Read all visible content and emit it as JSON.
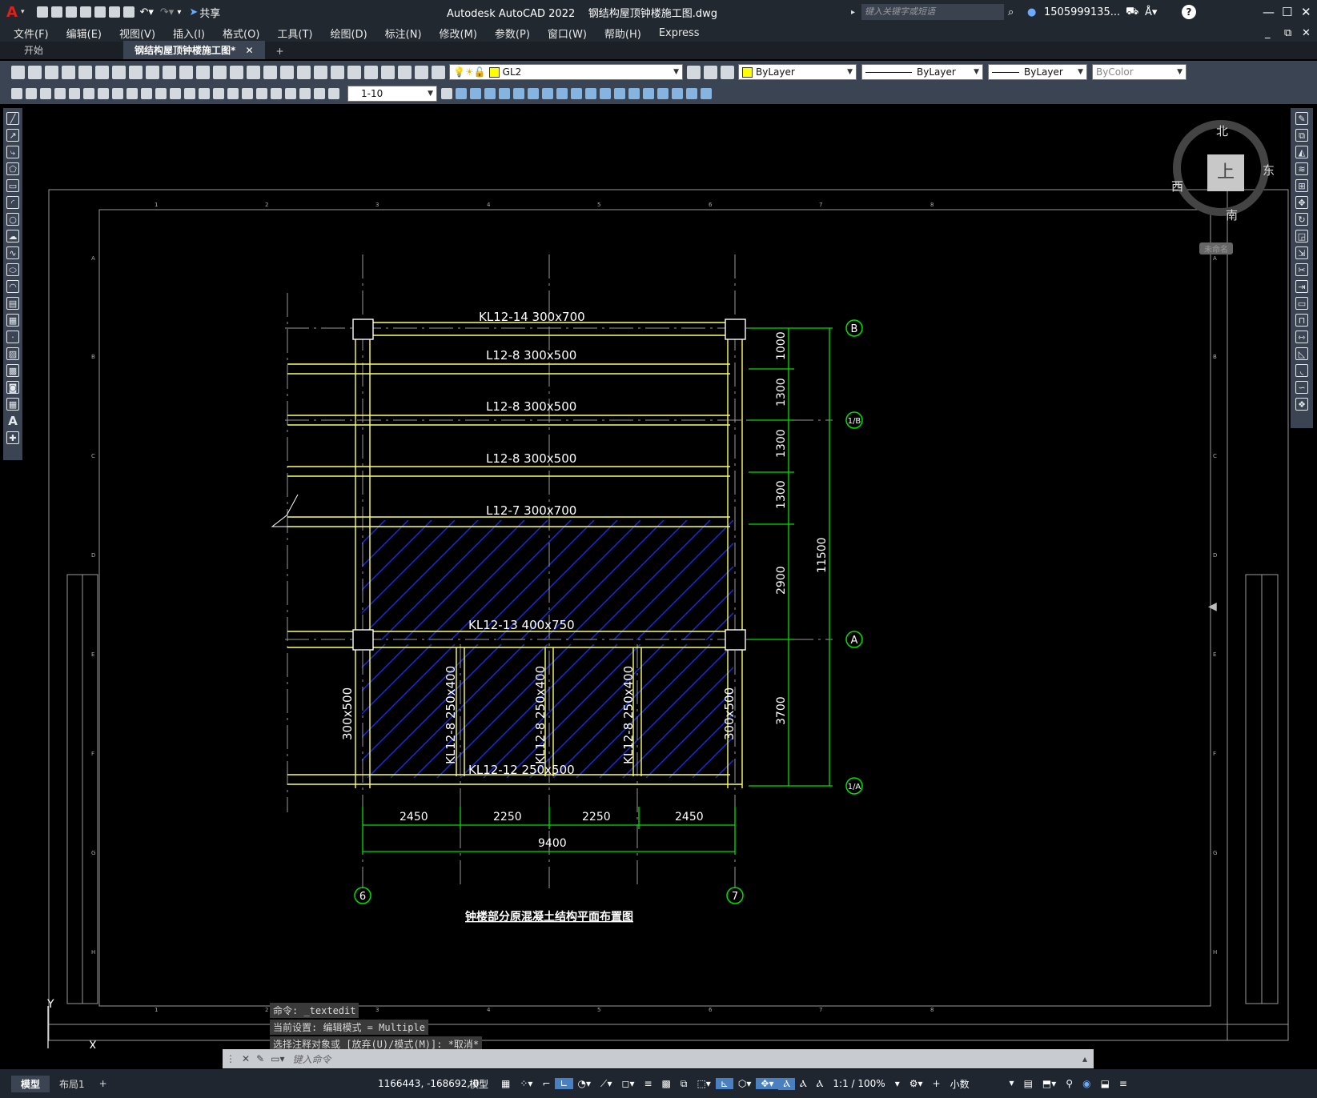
{
  "app": {
    "title": "Autodesk AutoCAD 2022",
    "filename": "钢结构屋顶钟楼施工图.dwg",
    "share_label": "共享",
    "search_placeholder": "键入关键字或短语",
    "user": "1505999135...",
    "help": "?"
  },
  "menu": [
    "文件(F)",
    "编辑(E)",
    "视图(V)",
    "插入(I)",
    "格式(O)",
    "工具(T)",
    "绘图(D)",
    "标注(N)",
    "修改(M)",
    "参数(P)",
    "窗口(W)",
    "帮助(H)",
    "Express"
  ],
  "tabs": {
    "start": "开始",
    "active": "钢结构屋顶钟楼施工图*",
    "close": "✕",
    "add": "+"
  },
  "toolbar": {
    "layer": "GL2",
    "layer_color": "#ffff00",
    "color": "ByLayer",
    "linetype": "ByLayer",
    "lineweight": "ByLayer",
    "plotstyle": "ByColor",
    "dimstyle": "1-10"
  },
  "viewcube": {
    "north": "北",
    "south": "南",
    "east": "东",
    "west": "西",
    "face": "上",
    "wcs": "未命名"
  },
  "drawing": {
    "title": "钟楼部分原混凝土结构平面布置图",
    "beams": {
      "kl12_14": "KL12-14  300x700",
      "l12_8": "L12-8  300x500",
      "l12_7": "L12-7  300x700",
      "kl12_13": "KL12-13  400x750",
      "kl12_12": "KL12-12  250x500",
      "v1": "KL12-8  250x400",
      "side_left": "300x500",
      "side_right": "300x500"
    },
    "dims_right": [
      "1000",
      "1300",
      "1300",
      "1300",
      "2900",
      "3700"
    ],
    "dim_total_right": "11500",
    "dims_bottom": [
      "2450",
      "2250",
      "2250",
      "2450"
    ],
    "dim_total_bottom": "9400",
    "axes": {
      "b": "B",
      "b1": "1/B",
      "a": "A",
      "a1": "1/A",
      "six": "6",
      "seven": "7"
    },
    "frame_cols": [
      "1",
      "2",
      "3",
      "4",
      "5",
      "6",
      "7",
      "8"
    ],
    "frame_rows": [
      "A",
      "B",
      "C",
      "D",
      "E",
      "F",
      "G",
      "H"
    ],
    "ucs": {
      "x": "X",
      "y": "Y"
    }
  },
  "command": {
    "history": [
      "命令:  _textedit",
      "当前设置: 编辑模式 = Multiple",
      "选择注释对象或 [放弃(U)/模式(M)]: *取消*"
    ],
    "placeholder": "键入命令"
  },
  "status": {
    "model_tab": "模型",
    "layout_tab": "布局1",
    "add": "+",
    "coords": "1166443, -168692, 0",
    "model": "模型",
    "scale": "1:1 / 100%",
    "units": "小数"
  },
  "colors": {
    "wall": "#ffff66",
    "dim": "#00e000",
    "hatch": "#1a2ee0",
    "text": "#ffffff",
    "grid": "#9a9a9a"
  }
}
